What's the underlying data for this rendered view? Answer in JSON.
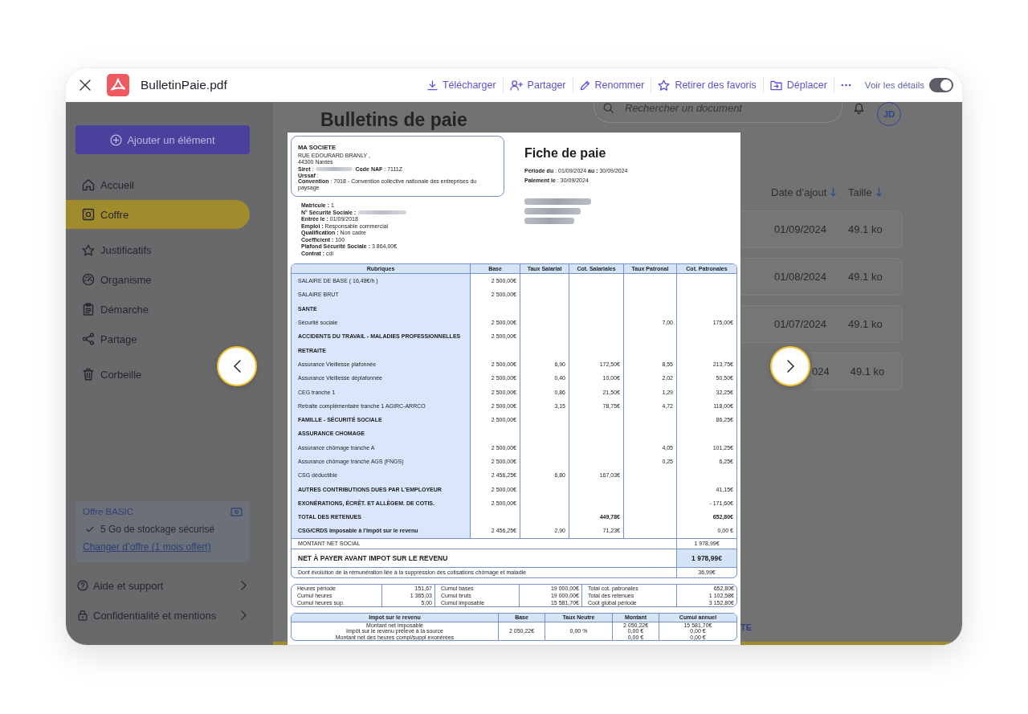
{
  "viewer": {
    "filename": "BulletinPaie.pdf",
    "actions": [
      {
        "kind": "download",
        "label": "Télécharger"
      },
      {
        "kind": "share",
        "label": "Partager"
      },
      {
        "kind": "rename",
        "label": "Renommer"
      },
      {
        "kind": "unfavorite",
        "label": "Retirer des favoris"
      },
      {
        "kind": "move",
        "label": "Déplacer"
      }
    ],
    "details_toggle": {
      "label": "Voir les détails",
      "on": true
    }
  },
  "app": {
    "sidebar": {
      "add_button": "Ajouter un élément",
      "items": [
        {
          "kind": "home",
          "label": "Accueil",
          "selected": false
        },
        {
          "kind": "vault",
          "label": "Coffre",
          "selected": true
        },
        {
          "kind": "documents",
          "label": "Justificatifs",
          "selected": false
        },
        {
          "kind": "organisations",
          "label": "Organisme",
          "selected": false
        },
        {
          "kind": "procedures",
          "label": "Démarche",
          "selected": false
        },
        {
          "kind": "share",
          "label": "Partage",
          "selected": false
        },
        {
          "kind": "trash",
          "label": "Corbeille",
          "selected": false
        }
      ],
      "offer": {
        "title": "Offre BASIC",
        "feature": "5 Go de stockage sécurisé",
        "link": "Changer d’offre (1 mois offert)"
      },
      "links": [
        {
          "kind": "help",
          "label": "Aide et support"
        },
        {
          "kind": "privacy",
          "label": "Confidentialité et mentions"
        }
      ]
    },
    "main": {
      "title": "Bulletins de paie",
      "search": {
        "placeholder": "Rechercher un document"
      },
      "avatar": "JD",
      "columns": [
        "Date d’ajout",
        "Taille"
      ],
      "rows": [
        {
          "date": "01/09/2024",
          "size": "49.1 ko"
        },
        {
          "date": "01/08/2024",
          "size": "49.1 ko"
        },
        {
          "date": "01/07/2024",
          "size": "49.1 ko"
        },
        {
          "date": "024",
          "size": "49.1 ko"
        }
      ],
      "footer_text": "TE"
    }
  },
  "document": {
    "company": {
      "name": "MA SOCIETE",
      "address": [
        "RUE EDOURARD BRANLY ,",
        "44300 Nantes"
      ],
      "siret": {
        "label": "**Siret** :",
        "redacted": true
      },
      "naf": "**Code NAF** : 7111Z",
      "urssaf": "**Urssaf** :",
      "convention": "**Convention** : 7018 - Convention collective nationale des entreprises du paysage"
    },
    "title": "Fiche de paie",
    "period": "**Période du** : 01/09/2024 **au :** 30/09/2024",
    "payment": "**Paiement le** : 30/09/2024",
    "recipient": {
      "redacted": true
    },
    "employee": [
      {
        "text": "**Matricule :** 1",
        "redacted": false
      },
      {
        "text": "**N° Sécurité Sociale :**",
        "redacted": true
      },
      {
        "text": "**Entrée le :** 01/09/2018",
        "redacted": false
      },
      {
        "text": "**Emploi :** Responsable commercial",
        "redacted": false
      },
      {
        "text": "**Qualification :** Non cadre",
        "redacted": false
      },
      {
        "text": "**Coefficient :** 100",
        "redacted": false
      },
      {
        "text": "**Plafond Sécurité Sociale :** 3 864,00€",
        "redacted": false
      },
      {
        "text": "**Contrat :** cdi",
        "redacted": false
      }
    ],
    "table": {
      "columns": [
        "Rubriques",
        "Base",
        "Taux Salarial",
        "Cot. Salariales",
        "Taux Patronal",
        "Cot. Patronales"
      ],
      "rows": [
        {
          "kind": "line",
          "label": "SALAIRE DE BASE ( 16,48€/h )",
          "base": "2 500,00€"
        },
        {
          "kind": "line",
          "label": "SALAIRE BRUT",
          "base": "2 500,00€"
        },
        {
          "kind": "section",
          "label": "SANTE"
        },
        {
          "kind": "line",
          "label": "Sécurité sociale",
          "base": "2 500,00€",
          "employer_rate": "7,00",
          "employer_amount": "175,00€"
        },
        {
          "kind": "section",
          "label": "ACCIDENTS DU TRAVAIL - MALADIES PROFESSIONNELLES",
          "base": "2 500,00€"
        },
        {
          "kind": "section",
          "label": "RETRAITE"
        },
        {
          "kind": "line",
          "label": "Assurance Vieillesse plafonnée",
          "base": "2 500,00€",
          "employee_rate": "6,90",
          "employee_amount": "172,50€",
          "employer_rate": "8,55",
          "employer_amount": "213,75€"
        },
        {
          "kind": "line",
          "label": "Assurance Vieillesse déplafonnée",
          "base": "2 500,00€",
          "employee_rate": "0,40",
          "employee_amount": "10,00€",
          "employer_rate": "2,02",
          "employer_amount": "50,50€"
        },
        {
          "kind": "line",
          "label": "CEG tranche 1",
          "base": "2 500,00€",
          "employee_rate": "0,86",
          "employee_amount": "21,50€",
          "employer_rate": "1,29",
          "employer_amount": "32,25€"
        },
        {
          "kind": "line",
          "label": "Retraite complémentaire tranche 1 AGIRC-ARRCO",
          "base": "2 500,00€",
          "employee_rate": "3,15",
          "employee_amount": "78,75€",
          "employer_rate": "4,72",
          "employer_amount": "118,00€"
        },
        {
          "kind": "section",
          "label": "FAMILLE - SÉCURITÉ SOCIALE",
          "base": "2 500,00€",
          "employer_amount": "86,25€"
        },
        {
          "kind": "section",
          "label": "ASSURANCE CHOMAGE"
        },
        {
          "kind": "line",
          "label": "Assurance chômage tranche A",
          "base": "2 500,00€",
          "employer_rate": "4,05",
          "employer_amount": "101,25€"
        },
        {
          "kind": "line",
          "label": "Assurance chômage tranche AGS (FNGS)",
          "base": "2 500,00€",
          "employer_rate": "0,25",
          "employer_amount": "6,25€"
        },
        {
          "kind": "line",
          "label": "CSG déductible",
          "base": "2 456,25€",
          "employee_rate": "6,80",
          "employee_amount": "167,03€"
        },
        {
          "kind": "section",
          "label": "AUTRES CONTRIBUTIONS DUES PAR L'EMPLOYEUR",
          "base": "2 500,00€",
          "employer_amount": "41,15€"
        },
        {
          "kind": "section",
          "label": "EXONÉRATIONS, ÉCRÊT. ET ALLÈGEM. DE COTIS.",
          "base": "2 500,00€",
          "employer_amount": "- 171,60€"
        },
        {
          "kind": "total",
          "label": "TOTAL DES RETENUES",
          "employee_amount": "449,78€",
          "employer_amount": "652,80€"
        },
        {
          "kind": "section",
          "label": "CSG/CRDS imposable à l'impôt sur le revenu",
          "base": "2 456,25€",
          "employee_rate": "2,90",
          "employee_amount": "71,23€",
          "employer_amount": "0,00 €"
        }
      ]
    },
    "summary": [
      {
        "kind": "plain",
        "label": "MONTANT NET SOCIAL",
        "value": "1 978,99€"
      },
      {
        "kind": "highlight",
        "label": "NET À PAYER AVANT IMPOT SUR LE REVENU",
        "value": "1 978,99€"
      },
      {
        "kind": "plain",
        "label": "Dont évolution de la rémunération liée à la suppression des cotisations chômage et maladie",
        "value": "36,99€"
      }
    ],
    "totals": [
      [
        "Heures période",
        "151,67",
        "Cumul bases",
        "19 000,00€",
        "Total cot. patronales",
        "652,80€"
      ],
      [
        "Cumul heures",
        "1 365,03",
        "Cumul bruts",
        "19 000,00€",
        "Total des retenues",
        "1 102,58€"
      ],
      [
        "Cumul heures sup.",
        "5,00",
        "Cumul imposable",
        "15 581,70€",
        "Coût global période",
        "3 152,80€"
      ]
    ],
    "income_tax": {
      "columns": [
        "Impot sur le revenu",
        "Base",
        "Taux Neutre",
        "Montant",
        "Cumul annuel"
      ],
      "lines": [
        "Montant net imposable",
        "Impôt sur le revenu prélevé à la source",
        "Montant net des heures compl/suppl exonérées"
      ],
      "base": "2 050,22€",
      "rate": "0,00 %",
      "amounts": [
        "2 050,22€",
        "0,00 €",
        "0,00 €"
      ],
      "annual": [
        "15 581,70€",
        "0,00 €",
        "0,00 €"
      ]
    }
  }
}
